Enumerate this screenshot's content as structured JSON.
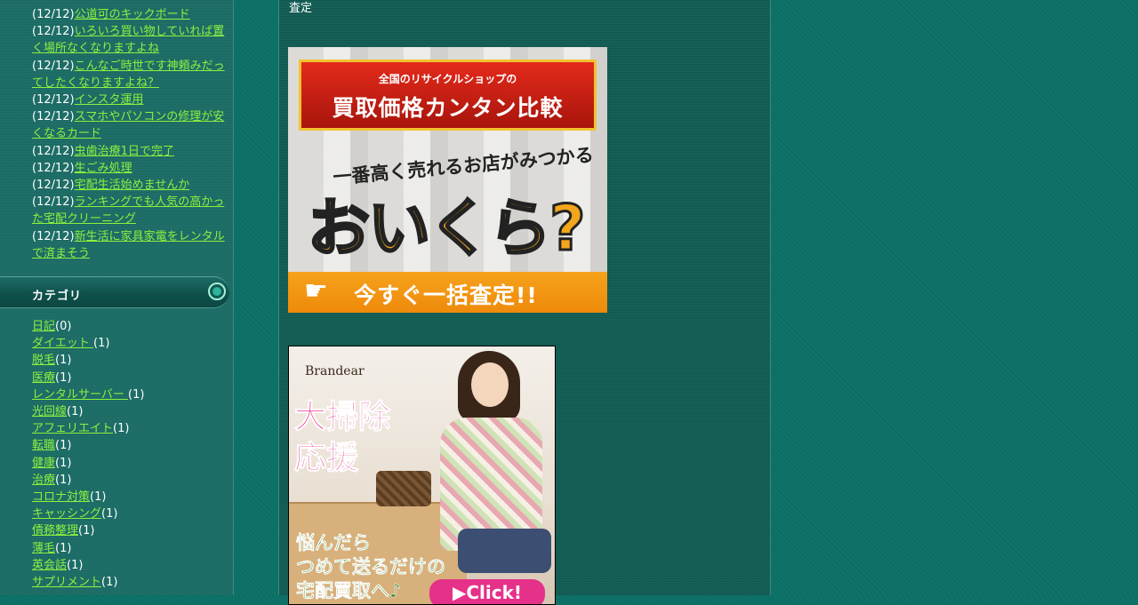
{
  "sidebar": {
    "recent_posts": [
      {
        "date": "(12/12)",
        "title": "公道可のキックボード "
      },
      {
        "date": "(12/12)",
        "title": "いろいろ買い物していれば置く場所なくなりますよね "
      },
      {
        "date": "(12/12)",
        "title": "こんなご時世です神頼みだってしたくなりますよね？"
      },
      {
        "date": "(12/12)",
        "title": "インスタ運用"
      },
      {
        "date": "(12/12)",
        "title": "スマホやパソコンの修理が安くなるカード"
      },
      {
        "date": "(12/12)",
        "title": "虫歯治療1日で完了"
      },
      {
        "date": "(12/12)",
        "title": "生ごみ処理"
      },
      {
        "date": "(12/12)",
        "title": "宅配生活始めませんか"
      },
      {
        "date": "(12/12)",
        "title": "ランキングでも人気の高かった宅配クリーニング"
      },
      {
        "date": "(12/12)",
        "title": "新生活に家具家電をレンタルで済まそう"
      }
    ],
    "category_header": "カテゴリ",
    "categories": [
      {
        "name": "日記",
        "count": "(0)"
      },
      {
        "name": "ダイエット ",
        "count": "(1)"
      },
      {
        "name": "脱毛",
        "count": "(1)"
      },
      {
        "name": "医療",
        "count": "(1)"
      },
      {
        "name": "レンタルサーバー ",
        "count": "(1)"
      },
      {
        "name": "光回線",
        "count": "(1)"
      },
      {
        "name": "アフェリエイト",
        "count": "(1)"
      },
      {
        "name": "転職",
        "count": "(1)"
      },
      {
        "name": "健康",
        "count": "(1)"
      },
      {
        "name": "治療",
        "count": "(1)"
      },
      {
        "name": "コロナ対策",
        "count": "(1)"
      },
      {
        "name": "キャッシング",
        "count": "(1)"
      },
      {
        "name": "債務整理",
        "count": "(1)"
      },
      {
        "name": "薄毛",
        "count": "(1)"
      },
      {
        "name": "英会話",
        "count": "(1)"
      },
      {
        "name": "サプリメント",
        "count": "(1)"
      }
    ]
  },
  "main": {
    "top_text": "査定",
    "banner1": {
      "subtitle": "全国のリサイクルショップの",
      "title": "買取価格カンタン比較",
      "tagline": "一番高く売れるお店がみつかる",
      "logo": "おいくら?",
      "cta": "今すぐ一括査定!!"
    },
    "banner2": {
      "brand": "Brandear",
      "headline1": "大掃除",
      "headline2": "応援",
      "line1": "悩んだら",
      "line2": "つめて送るだけの",
      "line3": "宅配買取へ♪",
      "button": "▶Click!"
    }
  },
  "colors": {
    "link": "#8cf13f",
    "background": "#0b6f66",
    "accent_orange": "#f6a21b",
    "accent_pink": "#e5318a"
  }
}
